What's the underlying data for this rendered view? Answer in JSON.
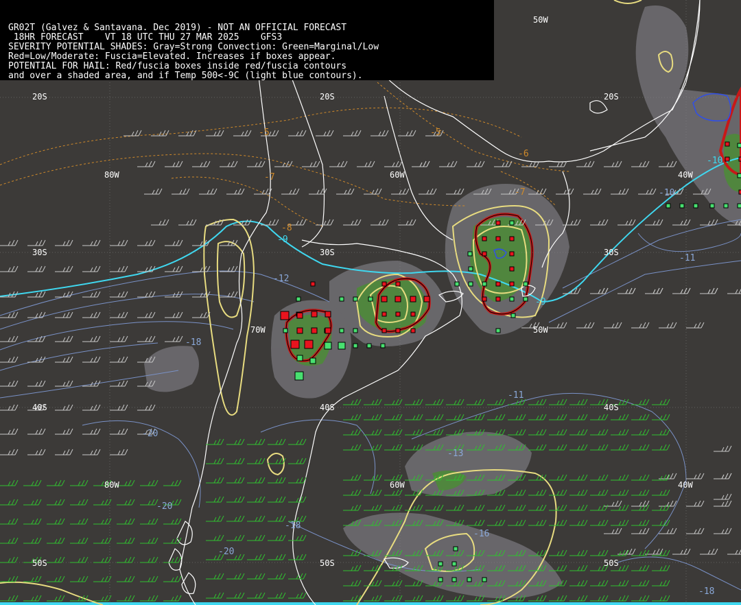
{
  "header": {
    "line1": "GR02T (Galvez & Santavana. Dec 2019) - NOT AN OFFICIAL FORECAST",
    "line2": " 18HR FORECAST    VT 18 UTC THU 27 MAR 2025    GFS3",
    "line3": "SEVERITY POTENTIAL SHADES: Gray=Strong Convection: Green=Marginal/Low",
    "line4": "Red=Low/Moderate: Fuscia=Elevated. Increases if boxes appear.",
    "line5": "POTENTIAL FOR HAIL: Red/fuscia boxes inside red/fuscia contours",
    "line6": "and over a shaded area, and if Temp 500<-9C (light blue contours)."
  },
  "grid_labels": {
    "lon_50w_top": "50W",
    "lat_20s_a": "20S",
    "lat_20s_b": "20S",
    "lat_20s_c": "20S",
    "lon_80w_a": "80W",
    "lon_60w_a": "60W",
    "lon_40w_a": "40W",
    "lat_30s_a": "30S",
    "lat_30s_b": "30S",
    "lat_30s_c": "30S",
    "lon_70w": "70W",
    "lon_50w_mid": "50W",
    "lat_40s_a": "40S",
    "lat_40s_b": "40S",
    "lat_40s_c": "40S",
    "lon_80w_b": "80W",
    "lon_60w_b": "60W",
    "lon_40w_b": "40W",
    "lat_50s_a": "50S",
    "lat_50s_b": "50S",
    "lat_50s_c": "50S"
  },
  "contour_labels": {
    "o_m5_a": "-5",
    "o_m5_b": "-5",
    "o_m6": "-6",
    "o_m7": "-7",
    "o_m8": "-8",
    "o_m7_b": "-7",
    "c_m9_a": "-9",
    "c_m9_b": "-9",
    "c_m10": "-10",
    "b_m10": "-10",
    "b_m11_a": "-11",
    "b_m11_b": "-11",
    "b_m12": "-12",
    "b_m18_a": "-18",
    "b_m18_b": "-18",
    "b_m18_c": "-18",
    "b_m20_a": "-20",
    "b_m20_b": "-20",
    "b_m20_c": "-20",
    "b_m13": "-13",
    "b_m16": "-16"
  },
  "colors": {
    "background": "#3c3a38",
    "shade_gray": "#6d6c70",
    "shade_green": "#4e8a3a",
    "temp_contour": "#d08a2a",
    "cold_contour": "#3fd8f0",
    "blue_contour": "#7a92c8",
    "yellow_contour": "#e8dc80",
    "hail_contour": "#c81818",
    "box_red": "#e8141e",
    "box_green": "#48e070",
    "coast": "#ffffff",
    "barb_gray": "#c8c8c8",
    "barb_green": "#30c030"
  }
}
